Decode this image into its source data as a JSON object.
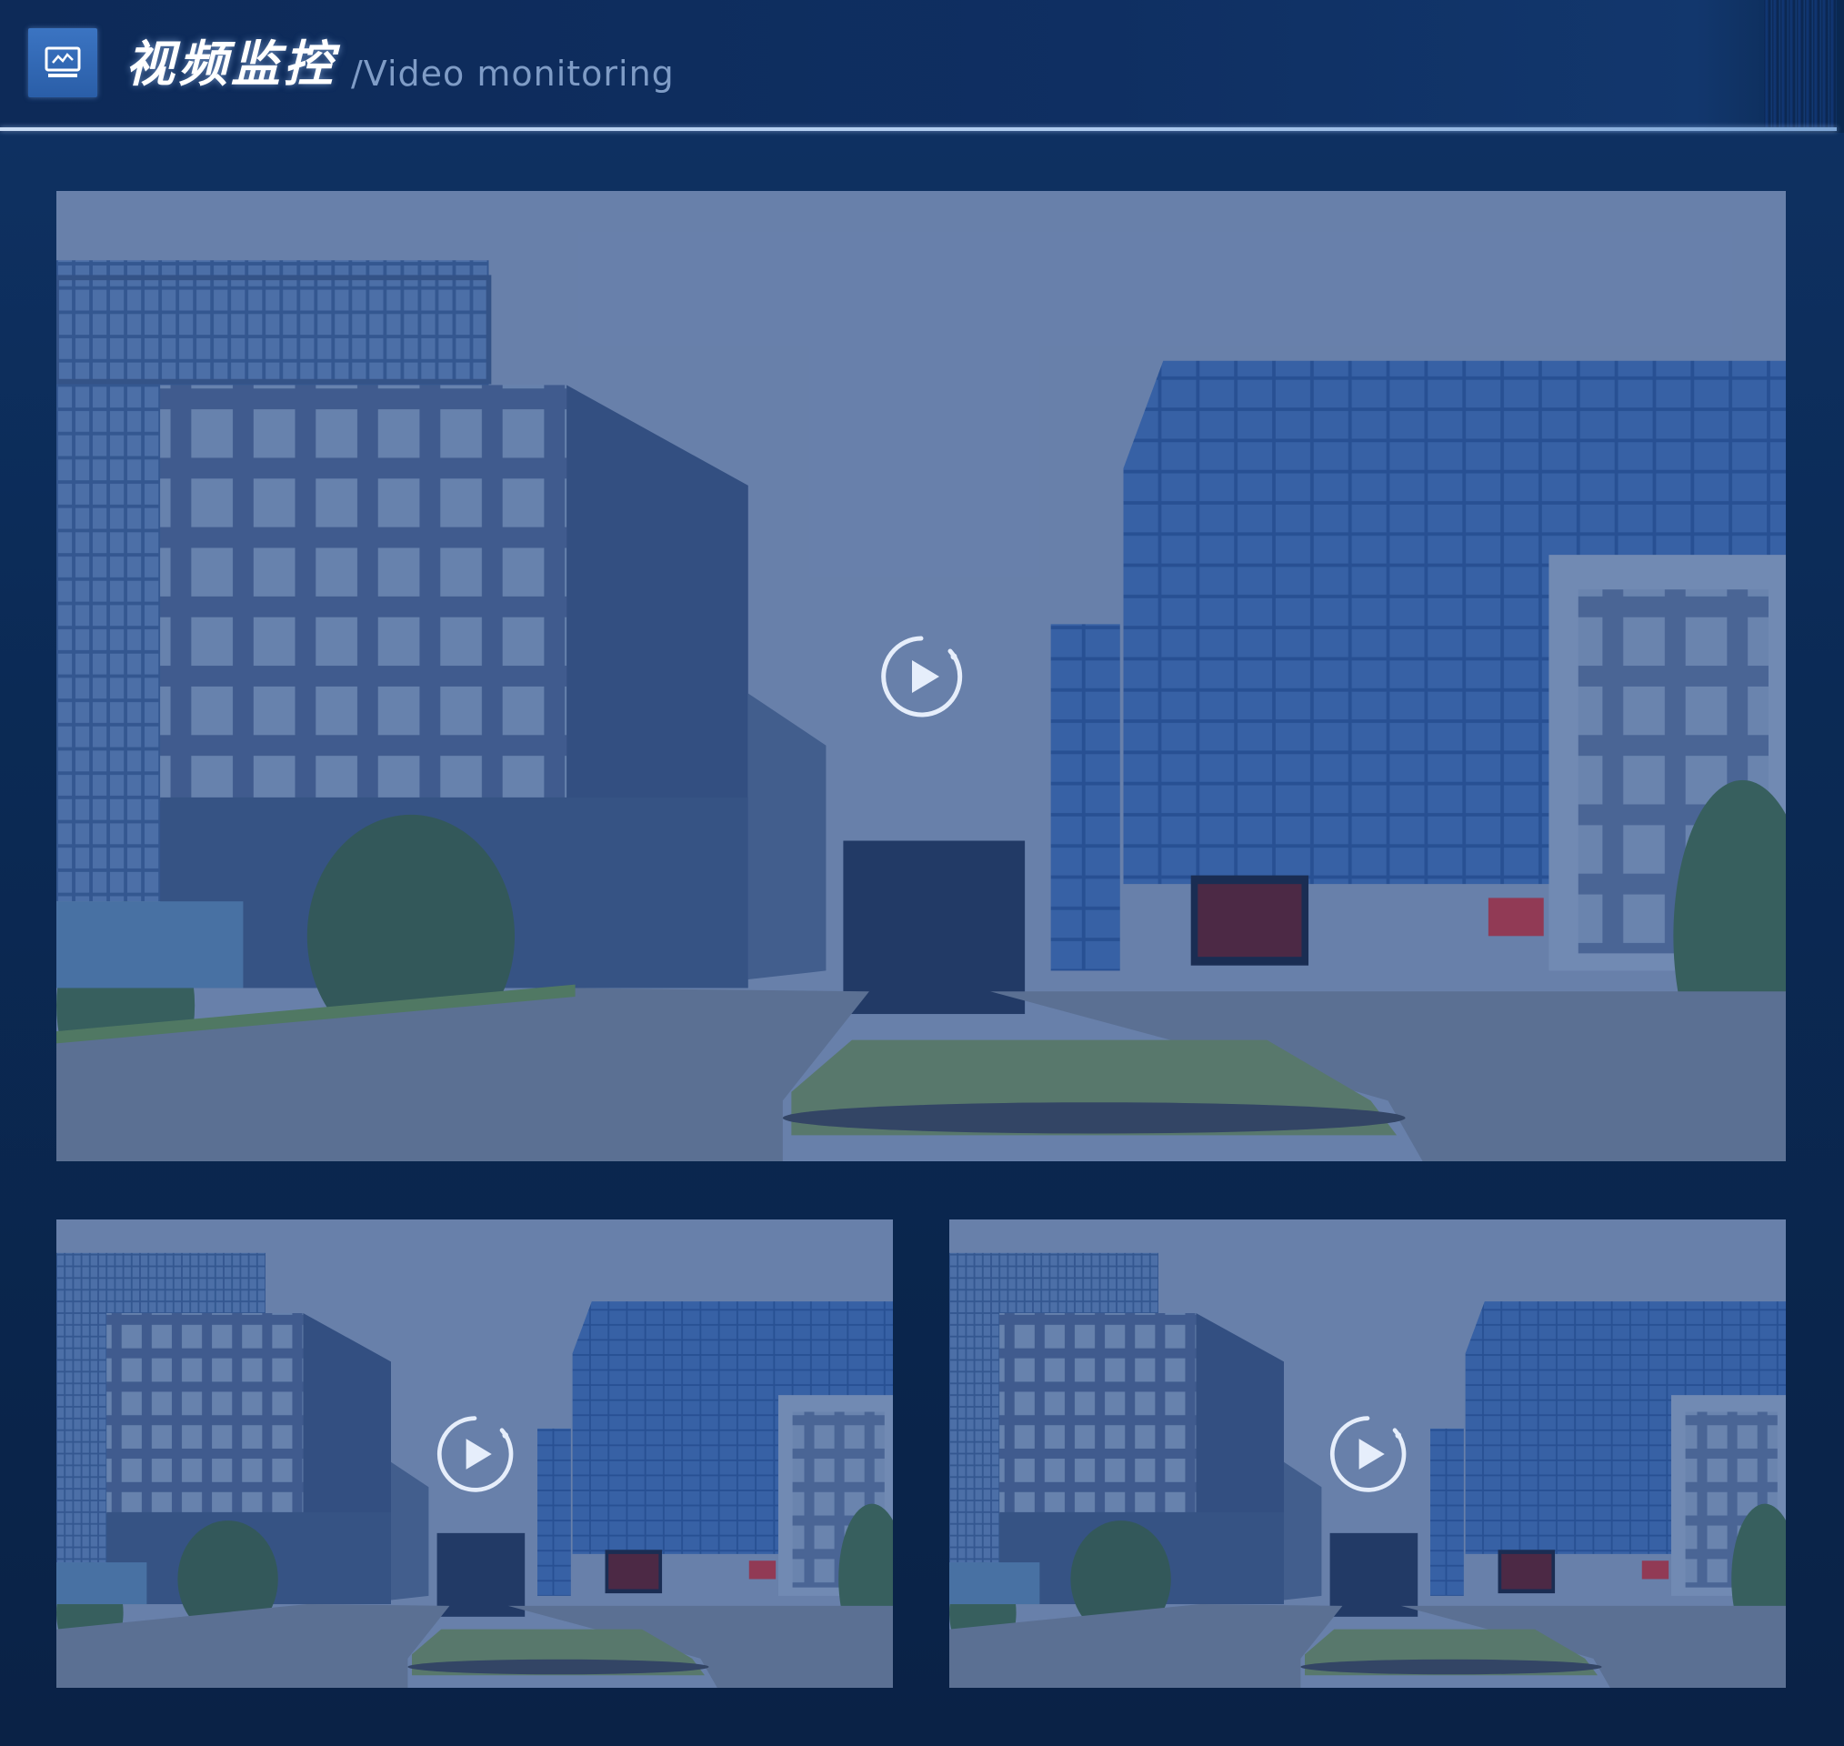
{
  "header": {
    "title": "视频监控",
    "subtitle": "/Video monitoring",
    "icon": "monitor-icon"
  },
  "colors": {
    "background": "#0a2347",
    "header_line": "#c9dcf5",
    "title": "#ffffff",
    "subtitle": "#7f9cc6"
  },
  "videos": [
    {
      "id": "main",
      "play_icon": "play-icon"
    },
    {
      "id": "sub-1",
      "play_icon": "play-icon"
    },
    {
      "id": "sub-2",
      "play_icon": "play-icon"
    }
  ]
}
